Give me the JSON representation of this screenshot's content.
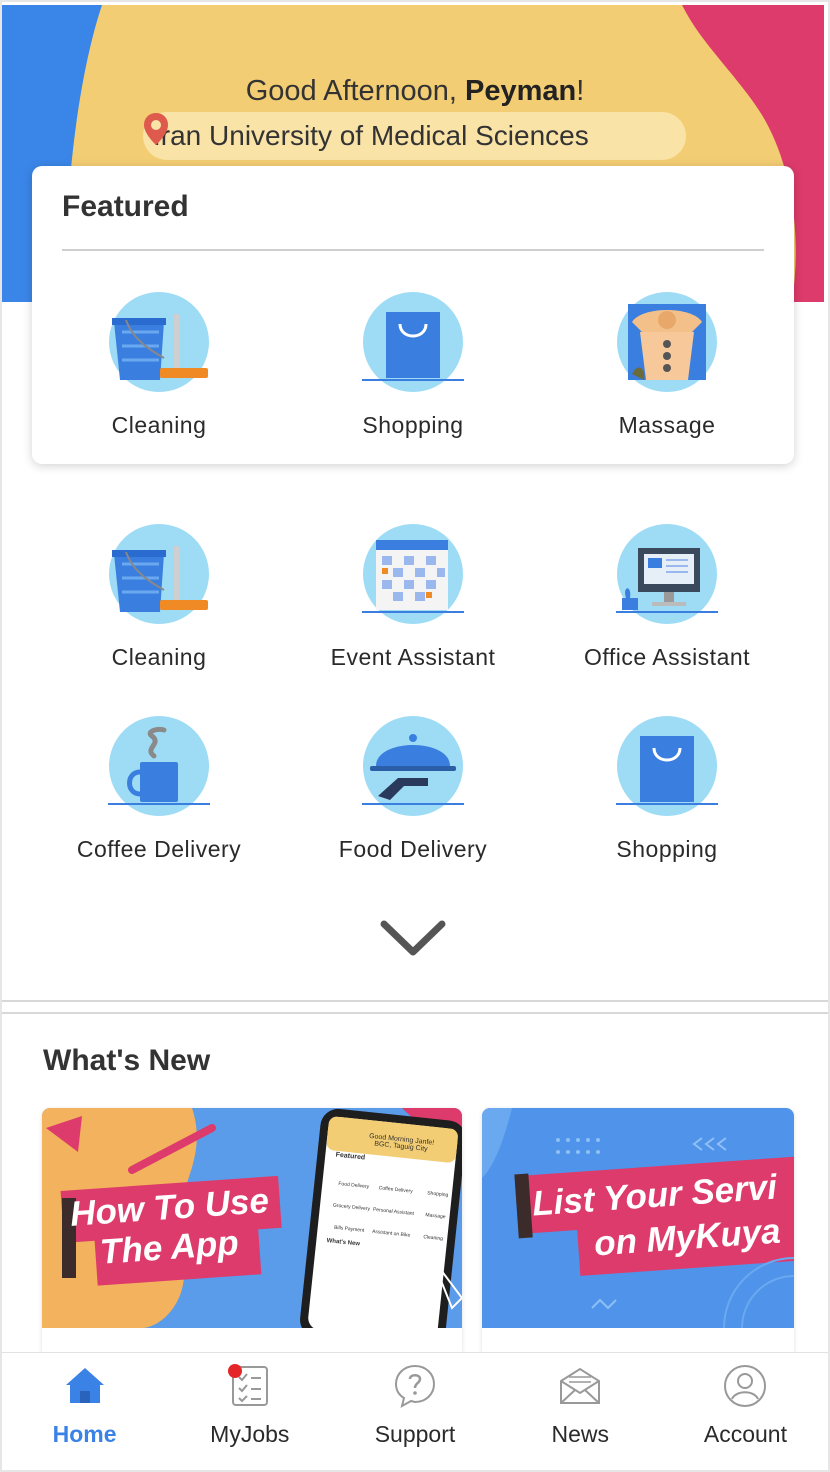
{
  "header": {
    "greeting_prefix": "Good Afternoon, ",
    "user_name": "Peyman",
    "greeting_suffix": "!",
    "location": "Iran University of Medical Sciences"
  },
  "featured": {
    "title": "Featured",
    "items": [
      {
        "label": "Cleaning",
        "icon": "cleaning-icon"
      },
      {
        "label": "Shopping",
        "icon": "shopping-bag-icon"
      },
      {
        "label": "Massage",
        "icon": "massage-icon"
      }
    ]
  },
  "services": [
    {
      "label": "Cleaning",
      "icon": "cleaning-icon"
    },
    {
      "label": "Event Assistant",
      "icon": "calendar-icon"
    },
    {
      "label": "Office Assistant",
      "icon": "computer-icon"
    },
    {
      "label": "Coffee Delivery",
      "icon": "coffee-cup-icon"
    },
    {
      "label": "Food Delivery",
      "icon": "food-cloche-icon"
    },
    {
      "label": "Shopping",
      "icon": "shopping-bag-icon"
    }
  ],
  "whats_new": {
    "title": "What's New",
    "cards": [
      {
        "title_line1": "How To Use",
        "title_line2": "The App",
        "phone_greeting": "Good Morning Janfe!",
        "phone_location": "BGC, Taguig City",
        "phone_featured": "Featured",
        "phone_whatsnew": "What's New",
        "phone_items": [
          "Food Delivery",
          "Coffee Delivery",
          "Shopping",
          "Grocery Delivery",
          "Personal Assistant",
          "Massage",
          "Bills Payment",
          "Assistant on Bike",
          "Cleaning"
        ]
      },
      {
        "title_line1": "List Your Servi",
        "title_line2": "on MyKuya"
      }
    ]
  },
  "tabbar": {
    "items": [
      {
        "label": "Home",
        "icon": "home-icon",
        "active": true
      },
      {
        "label": "MyJobs",
        "icon": "checklist-icon",
        "badge": true
      },
      {
        "label": "Support",
        "icon": "help-icon"
      },
      {
        "label": "News",
        "icon": "news-envelope-icon"
      },
      {
        "label": "Account",
        "icon": "account-icon"
      }
    ]
  },
  "colors": {
    "header_yellow": "#f3cd73",
    "header_blue": "#3a86e8",
    "header_pink": "#dd3b6b",
    "icon_circle": "#9edcf6",
    "accent_blue": "#3b82e6",
    "badge_red": "#e52629"
  }
}
